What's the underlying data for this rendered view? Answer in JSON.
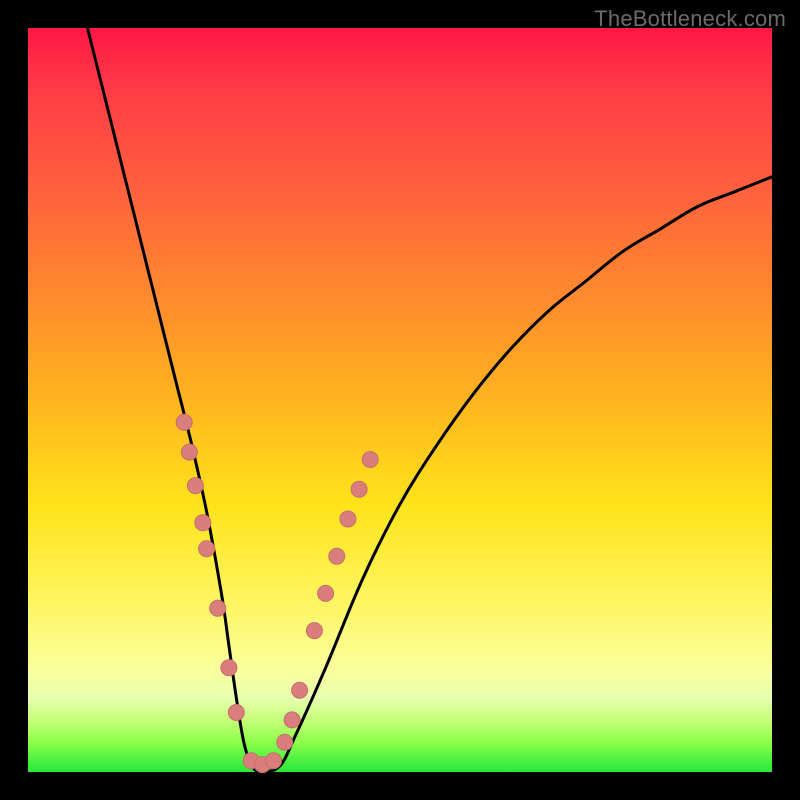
{
  "watermark": "TheBottleneck.com",
  "colors": {
    "frame": "#000000",
    "curve": "#000000",
    "marker_fill": "#d97d7d",
    "marker_stroke": "#c96c6c"
  },
  "chart_data": {
    "type": "line",
    "title": "",
    "xlabel": "",
    "ylabel": "",
    "xlim": [
      0,
      100
    ],
    "ylim": [
      0,
      100
    ],
    "series": [
      {
        "name": "bottleneck-curve",
        "x": [
          8,
          10,
          12,
          14,
          16,
          18,
          20,
          22,
          24,
          26,
          27,
          28,
          29,
          30,
          31,
          32,
          34,
          36,
          40,
          45,
          50,
          55,
          60,
          65,
          70,
          75,
          80,
          85,
          90,
          95,
          100
        ],
        "y": [
          100,
          92,
          84,
          76,
          68,
          60,
          52,
          44,
          35,
          24,
          17,
          10,
          4,
          1,
          0,
          0,
          1,
          5,
          14,
          26,
          36,
          44,
          51,
          57,
          62,
          66,
          70,
          73,
          76,
          78,
          80
        ]
      }
    ],
    "markers": [
      {
        "x": 21.0,
        "y": 47.0
      },
      {
        "x": 21.7,
        "y": 43.0
      },
      {
        "x": 22.5,
        "y": 38.5
      },
      {
        "x": 23.5,
        "y": 33.5
      },
      {
        "x": 24.0,
        "y": 30.0
      },
      {
        "x": 25.5,
        "y": 22.0
      },
      {
        "x": 27.0,
        "y": 14.0
      },
      {
        "x": 28.0,
        "y": 8.0
      },
      {
        "x": 30.0,
        "y": 1.5
      },
      {
        "x": 31.5,
        "y": 1.0
      },
      {
        "x": 33.0,
        "y": 1.5
      },
      {
        "x": 34.5,
        "y": 4.0
      },
      {
        "x": 35.5,
        "y": 7.0
      },
      {
        "x": 36.5,
        "y": 11.0
      },
      {
        "x": 38.5,
        "y": 19.0
      },
      {
        "x": 40.0,
        "y": 24.0
      },
      {
        "x": 41.5,
        "y": 29.0
      },
      {
        "x": 43.0,
        "y": 34.0
      },
      {
        "x": 44.5,
        "y": 38.0
      },
      {
        "x": 46.0,
        "y": 42.0
      }
    ]
  }
}
